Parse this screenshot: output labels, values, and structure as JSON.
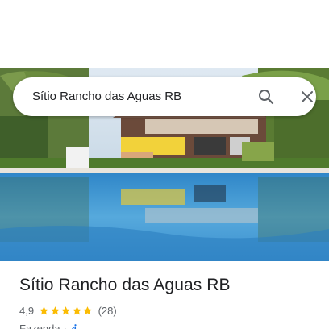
{
  "search": {
    "query": "Sítio Rancho das Aguas RB"
  },
  "place": {
    "name": "Sítio Rancho das Aguas RB",
    "rating": "4,9",
    "stars": 5,
    "reviews": "(28)",
    "category": "Fazenda",
    "separator": "·"
  },
  "colors": {
    "star": "#fbbc04",
    "accessibility": "#1a73e8",
    "text_primary": "#202124",
    "text_secondary": "#5f6368"
  },
  "icons": {
    "search": "search-icon",
    "close": "close-icon",
    "accessibility": "wheelchair-icon"
  }
}
